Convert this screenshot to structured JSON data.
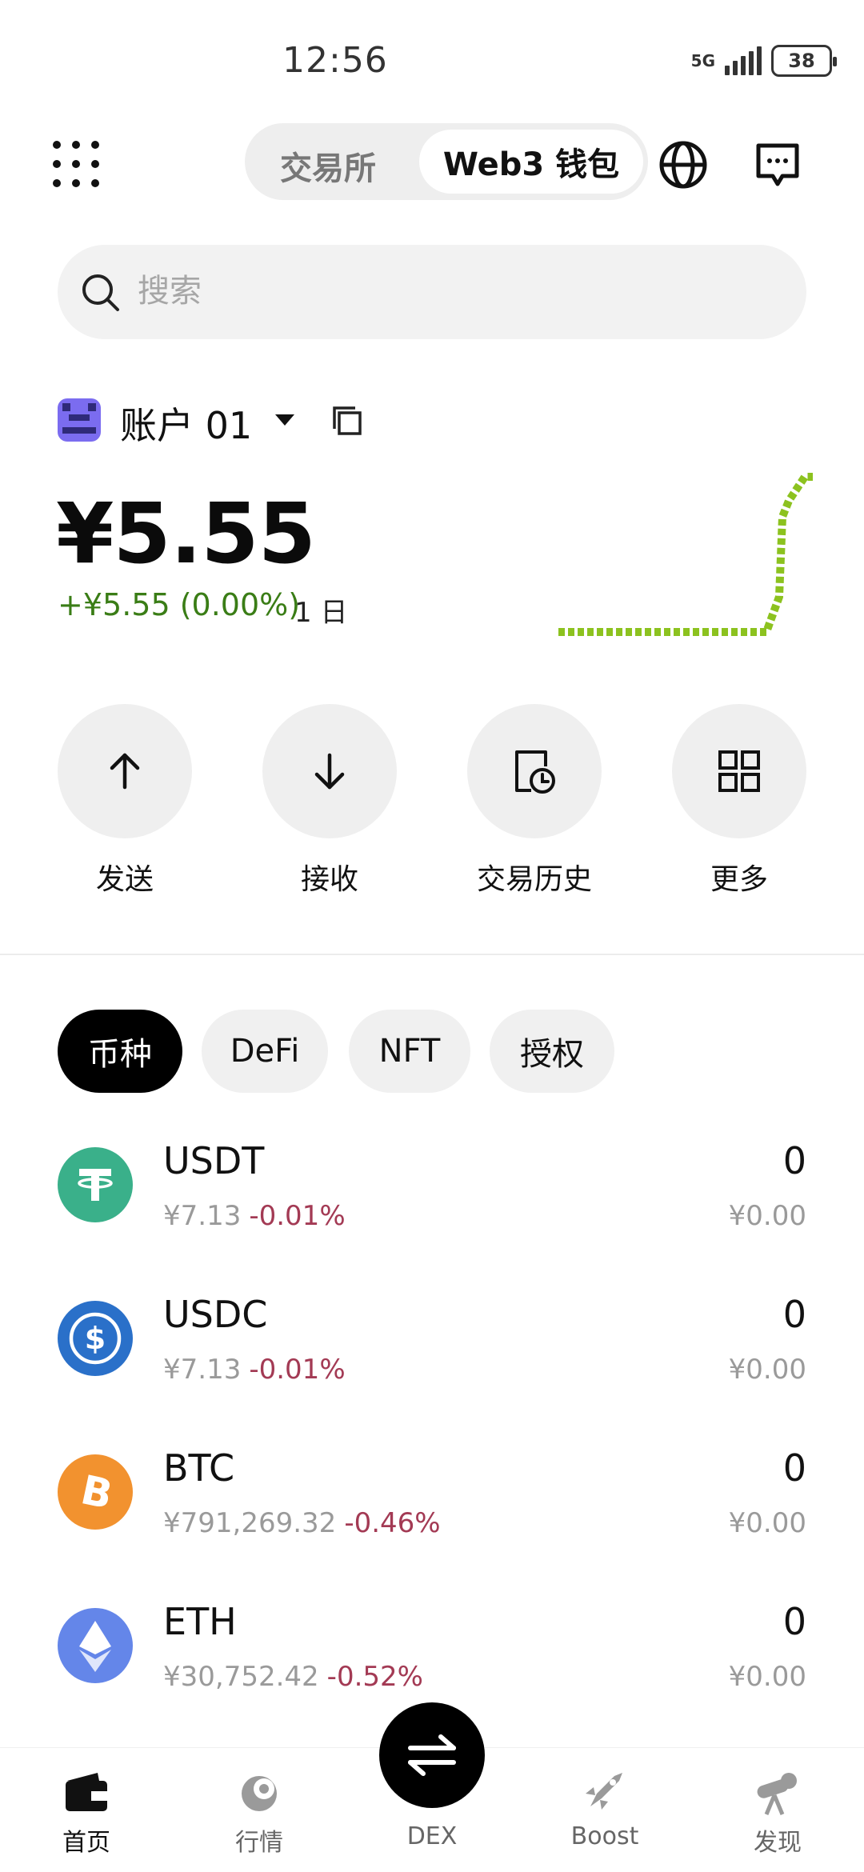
{
  "status_bar": {
    "time": "12:56",
    "network": "5G",
    "battery": "38"
  },
  "header": {
    "menu_icon": "grid-dots-icon",
    "tabs": [
      {
        "label": "交易所",
        "active": false
      },
      {
        "label": "Web3 钱包",
        "active": true
      }
    ],
    "globe_icon": "globe-icon",
    "message_icon": "chat-bubble-icon"
  },
  "search": {
    "placeholder": "搜索"
  },
  "account": {
    "name": "账户 01",
    "balance": "¥5.55",
    "change": "+¥5.55 (0.00%)",
    "period": "1 日"
  },
  "actions": [
    {
      "label": "发送",
      "icon": "arrow-up-icon"
    },
    {
      "label": "接收",
      "icon": "arrow-down-icon"
    },
    {
      "label": "交易历史",
      "icon": "history-icon"
    },
    {
      "label": "更多",
      "icon": "grid-icon"
    }
  ],
  "asset_tabs": [
    {
      "label": "币种",
      "active": true
    },
    {
      "label": "DeFi",
      "active": false
    },
    {
      "label": "NFT",
      "active": false
    },
    {
      "label": "授权",
      "active": false
    }
  ],
  "tokens": [
    {
      "symbol": "USDT",
      "price": "¥7.13",
      "change": "-0.01%",
      "amount": "0",
      "value": "¥0.00",
      "icon": "tether-icon",
      "color": "#3ab08a"
    },
    {
      "symbol": "USDC",
      "price": "¥7.13",
      "change": "-0.01%",
      "amount": "0",
      "value": "¥0.00",
      "icon": "usdc-icon",
      "color": "#2a70c9"
    },
    {
      "symbol": "BTC",
      "price": "¥791,269.32",
      "change": "-0.46%",
      "amount": "0",
      "value": "¥0.00",
      "icon": "bitcoin-icon",
      "color": "#f2922f"
    },
    {
      "symbol": "ETH",
      "price": "¥30,752.42",
      "change": "-0.52%",
      "amount": "0",
      "value": "¥0.00",
      "icon": "ethereum-icon",
      "color": "#6486e9"
    }
  ],
  "colors": {
    "positive": "#3a7d16",
    "negative": "#a33a54",
    "sparkline": "#8cc21f"
  },
  "bottom_nav": [
    {
      "label": "首页",
      "icon": "wallet-icon",
      "active": true
    },
    {
      "label": "行情",
      "icon": "market-icon",
      "active": false
    },
    {
      "label": "DEX",
      "icon": "swap-icon",
      "active": false
    },
    {
      "label": "Boost",
      "icon": "rocket-icon",
      "active": false
    },
    {
      "label": "发现",
      "icon": "telescope-icon",
      "active": false
    }
  ]
}
